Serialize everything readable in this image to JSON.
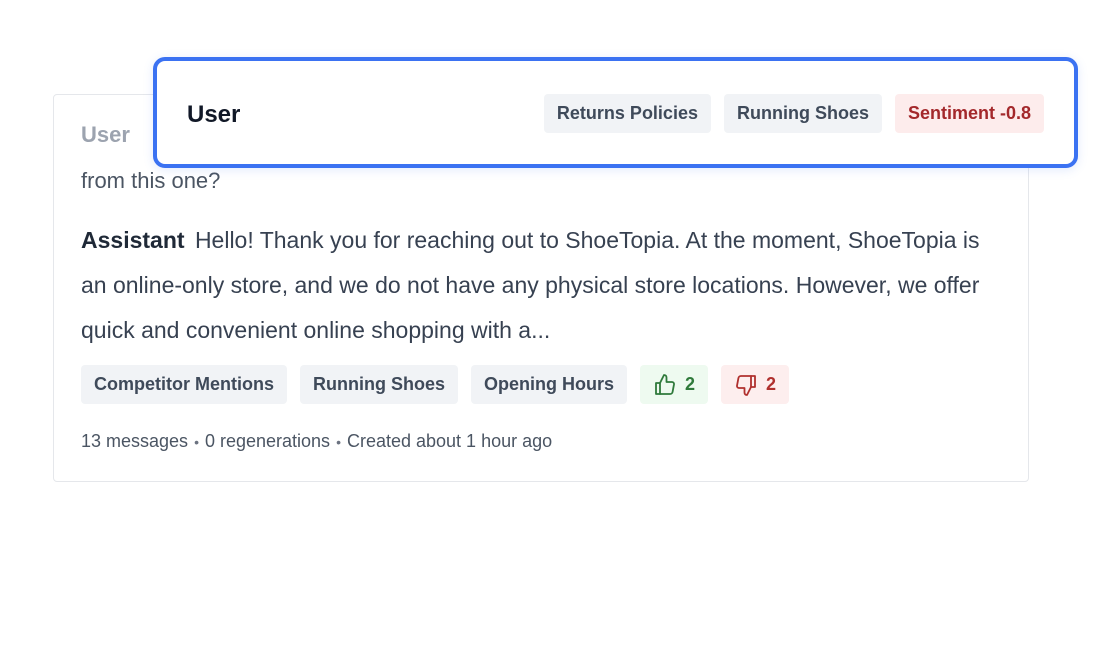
{
  "card": {
    "user_label": "User",
    "user_snippet_partial": "from this one?",
    "assistant_label": "Assistant",
    "assistant_text": "Hello! Thank you for reaching out to ShoeTopia. At the moment, ShoeTopia is an online-only store, and we do not have any physical store locations. However, we offer quick and convenient online shopping with a...",
    "tags": [
      "Competitor Mentions",
      "Running Shoes",
      "Opening Hours"
    ],
    "thumbs_up_count": "2",
    "thumbs_down_count": "2",
    "meta": {
      "messages": "13 messages",
      "regenerations": "0 regenerations",
      "created": "Created about 1 hour ago"
    }
  },
  "overlay": {
    "title": "User",
    "tags": [
      "Returns Policies",
      "Running Shoes"
    ],
    "sentiment": "Sentiment -0.8"
  },
  "colors": {
    "accent_border": "#3b72f2",
    "positive": "#2f7a3b",
    "negative": "#a3282b"
  }
}
